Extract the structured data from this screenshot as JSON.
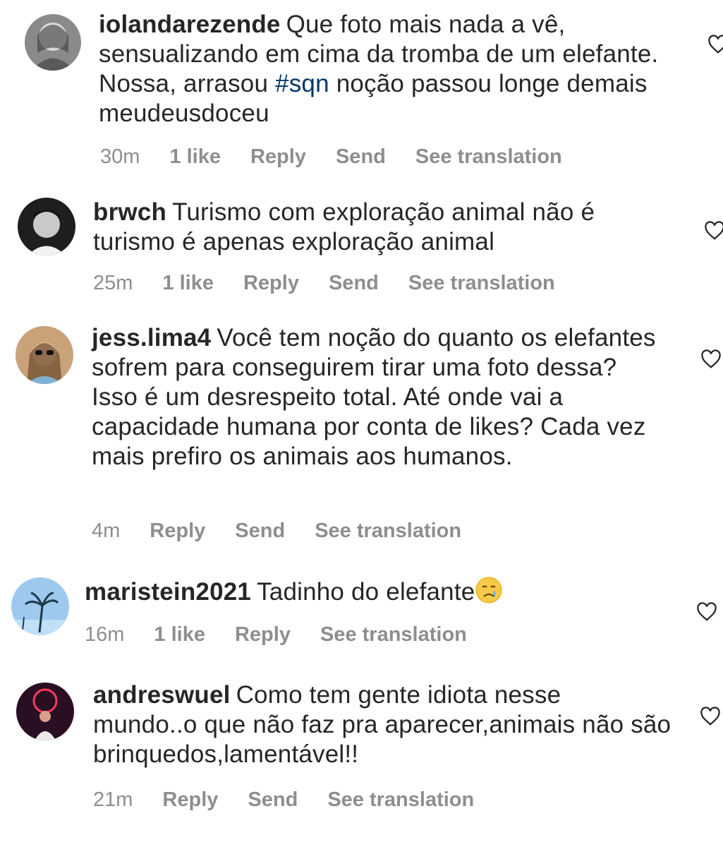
{
  "comments": [
    {
      "username": "iolandarezende",
      "text_before": "Que foto mais nada a vê, sensualizando em cima da tromba de um elefante. Nossa, arrasou ",
      "hashtag": "#sqn",
      "text_after": " noção passou longe demais meudeusdoceu",
      "time": "30m",
      "likes": "1 like",
      "reply": "Reply",
      "send": "Send",
      "translate": "See translation"
    },
    {
      "username": "brwch",
      "text": "Turismo com exploração animal não é turismo é apenas exploração animal",
      "time": "25m",
      "likes": "1 like",
      "reply": "Reply",
      "send": "Send",
      "translate": "See translation"
    },
    {
      "username": "jess.lima4",
      "text": "Você tem noção do quanto os elefantes sofrem para conseguirem tirar uma foto dessa? Isso é um desrespeito total. Até onde vai a capacidade humana por conta de likes? Cada vez mais prefiro os animais aos humanos.",
      "time": "4m",
      "reply": "Reply",
      "send": "Send",
      "translate": "See translation"
    },
    {
      "username": "maristein2021",
      "text": "Tadinho do elefante",
      "emoji": "crying-face-emoji",
      "time": "16m",
      "likes": "1 like",
      "reply": "Reply",
      "translate": "See translation"
    },
    {
      "username": "andreswuel",
      "text": "Como tem gente idiota nesse mundo..o que não faz pra aparecer,animais não são brinquedos,lamentável!!",
      "time": "21m",
      "reply": "Reply",
      "send": "Send",
      "translate": "See translation"
    }
  ],
  "icons": {
    "like": "heart-outline-icon"
  },
  "colors": {
    "text": "#262626",
    "meta": "#8e8e8e",
    "hashtag": "#00376b"
  }
}
